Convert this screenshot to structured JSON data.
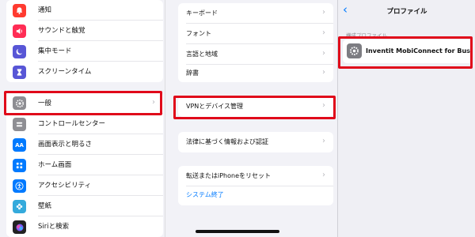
{
  "left_panel": {
    "top_items": [
      {
        "label": "通知",
        "icon": "bell-icon",
        "color": "#ff3b30"
      },
      {
        "label": "サウンドと触覚",
        "icon": "speaker-icon",
        "color": "#ff2d55"
      },
      {
        "label": "集中モード",
        "icon": "moon-icon",
        "color": "#5856d6"
      },
      {
        "label": "スクリーンタイム",
        "icon": "hourglass-icon",
        "color": "#5856d6"
      }
    ],
    "bottom_items": [
      {
        "label": "一般",
        "icon": "gear-icon",
        "color": "#8e8e93"
      },
      {
        "label": "コントロールセンター",
        "icon": "switches-icon",
        "color": "#8e8e93"
      },
      {
        "label": "画面表示と明るさ",
        "icon": "text-size-icon",
        "color": "#007aff",
        "glyph": "AA"
      },
      {
        "label": "ホーム画面",
        "icon": "grid-icon",
        "color": "#007aff"
      },
      {
        "label": "アクセシビリティ",
        "icon": "accessibility-icon",
        "color": "#007aff"
      },
      {
        "label": "壁紙",
        "icon": "flower-icon",
        "color": "#34aadc"
      },
      {
        "label": "Siriと検索",
        "icon": "siri-icon",
        "color": "#222222"
      }
    ]
  },
  "middle_panel": {
    "group1": [
      "キーボード",
      "フォント",
      "言語と地域",
      "辞書"
    ],
    "vpn": "VPNとデバイス管理",
    "legal": "法律に基づく情報および認証",
    "reset": "転送またはiPhoneをリセット",
    "shutdown": "システム終了"
  },
  "right_panel": {
    "back_icon": "chevron-left-icon",
    "title": "プロファイル",
    "section_header": "構成プロファイル",
    "profile_name": "Inventit MobiConnect for Busi..."
  },
  "colors": {
    "accent": "#007aff",
    "highlight": "#e0091a"
  }
}
